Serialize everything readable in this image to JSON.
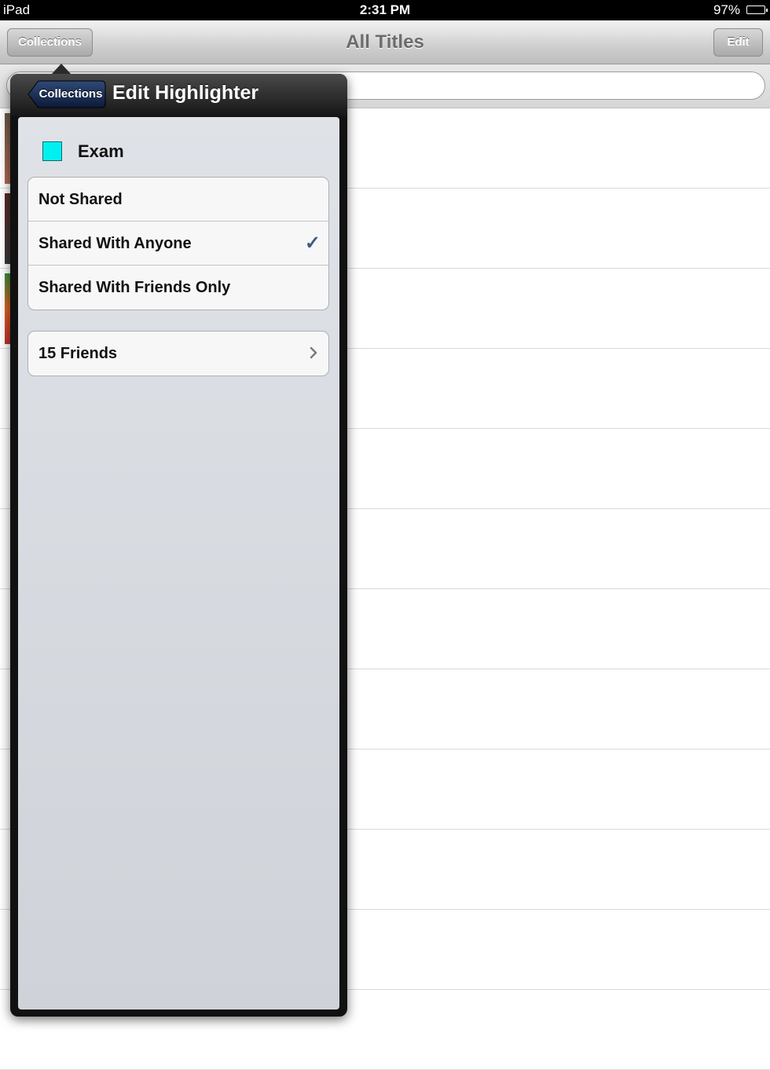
{
  "status_bar": {
    "device": "iPad",
    "time": "2:31 PM",
    "battery": "97%"
  },
  "nav_bar": {
    "title": "All Titles",
    "left_button": "Collections",
    "right_button": "Edit"
  },
  "popover": {
    "back_button": "Collections",
    "title": "Edit Highlighter",
    "highlighter": {
      "name": "Exam",
      "color": "#00f0f0"
    },
    "sharing_options": [
      {
        "label": "Not Shared",
        "selected": false
      },
      {
        "label": "Shared With Anyone",
        "selected": true,
        "check_glyph": "✓"
      },
      {
        "label": "Shared With Friends Only",
        "selected": false
      }
    ],
    "friends_row": {
      "label": "15 Friends",
      "icon": "chevron-right-icon"
    }
  },
  "colors": {
    "check": "#3f5a80",
    "popover_frame": "#111111"
  }
}
